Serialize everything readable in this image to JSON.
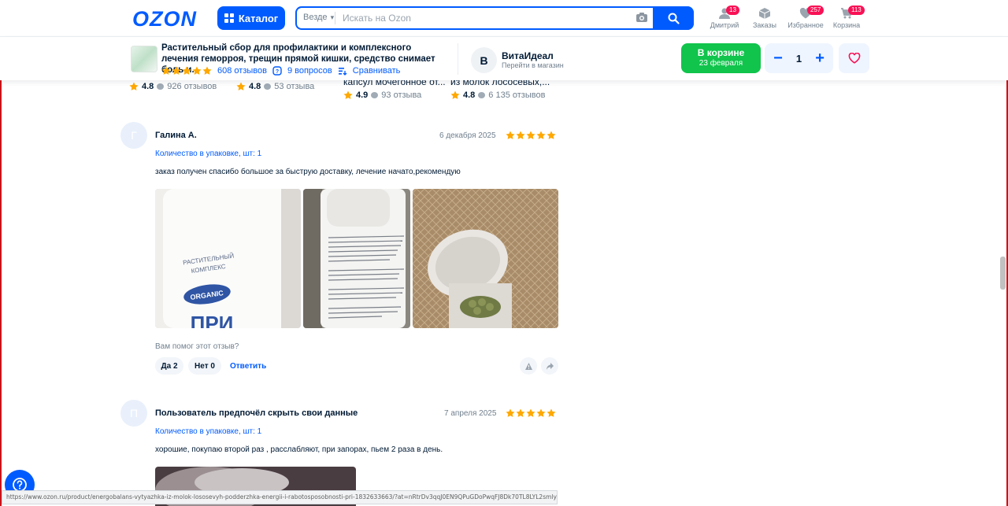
{
  "header": {
    "logo": "OZON",
    "catalog_label": "Каталог",
    "search_scope": "Везде",
    "search_placeholder": "Искать на Ozon",
    "nav": [
      {
        "label": "Дмитрий",
        "badge": "13"
      },
      {
        "label": "Заказы",
        "badge": ""
      },
      {
        "label": "Избранное",
        "badge": "257"
      },
      {
        "label": "Корзина",
        "badge": "113"
      }
    ]
  },
  "product_bar": {
    "title": "Растительный сбор для профилактики и комплексного лечения геморроя, трещин прямой кишки, средство снимает боль и...",
    "reviews_link": "608 отзывов",
    "questions_link": "9 вопросов",
    "compare_link": "Сравнивать",
    "rating_stars": 5,
    "shop": {
      "initial": "В",
      "name": "ВитаИдеал",
      "link": "Перейти в магазин"
    },
    "cart_button": {
      "line1": "В корзине",
      "line2": "23 февраля"
    },
    "quantity": "1"
  },
  "related": [
    {
      "title": "",
      "rating": "4.8",
      "reviews": "926 отзывов"
    },
    {
      "title": "",
      "rating": "4.8",
      "reviews": "53 отзыва"
    },
    {
      "title": "капсул мочегонное от...",
      "rating": "4.9",
      "reviews": "93 отзыва"
    },
    {
      "title": "из молок лососевых,...",
      "rating": "4.8",
      "reviews": "6 135 отзывов"
    }
  ],
  "reviews": [
    {
      "initial": "Г",
      "author": "Галина А.",
      "date": "6 декабря 2025",
      "stars": 5,
      "attribute": "Количество в упаковке, шт: 1",
      "text": "заказ получен спасибо большое за быструю доставку, лечение начато,рекомендую",
      "photo1_label_top": "РАСТИТЕЛЬНЫЙ",
      "photo1_label_bottom": "КОМПЛЕКС",
      "photo1_badge": "ORGANIC",
      "photo1_big": "ПРИ",
      "helpful_question": "Вам помог этот отзыв?",
      "yes_label": "Да 2",
      "no_label": "Нет 0",
      "reply_label": "Ответить"
    },
    {
      "initial": "П",
      "author": "Пользователь предпочёл скрыть свои данные",
      "date": "7 апреля 2025",
      "stars": 5,
      "attribute": "Количество в упаковке, шт: 1",
      "text": "хорошие, покупаю второй раз , расслабляют, при запорах, пьем 2 раза в день."
    }
  ],
  "status_url": "https://www.ozon.ru/product/energobalans-vytyazhka-iz-molok-lososevyh-podderzhka-energii-i-rabotosposobnosti-pri-1832633663/?at=nRtrDv3qqJ0EN9QPuGDoPwqFJ8Dk70TL8LYL2smlyDBv",
  "colors": {
    "brand": "#005bff",
    "cart_green": "#10c44c",
    "badge": "#f91155",
    "star": "#ffa800"
  }
}
